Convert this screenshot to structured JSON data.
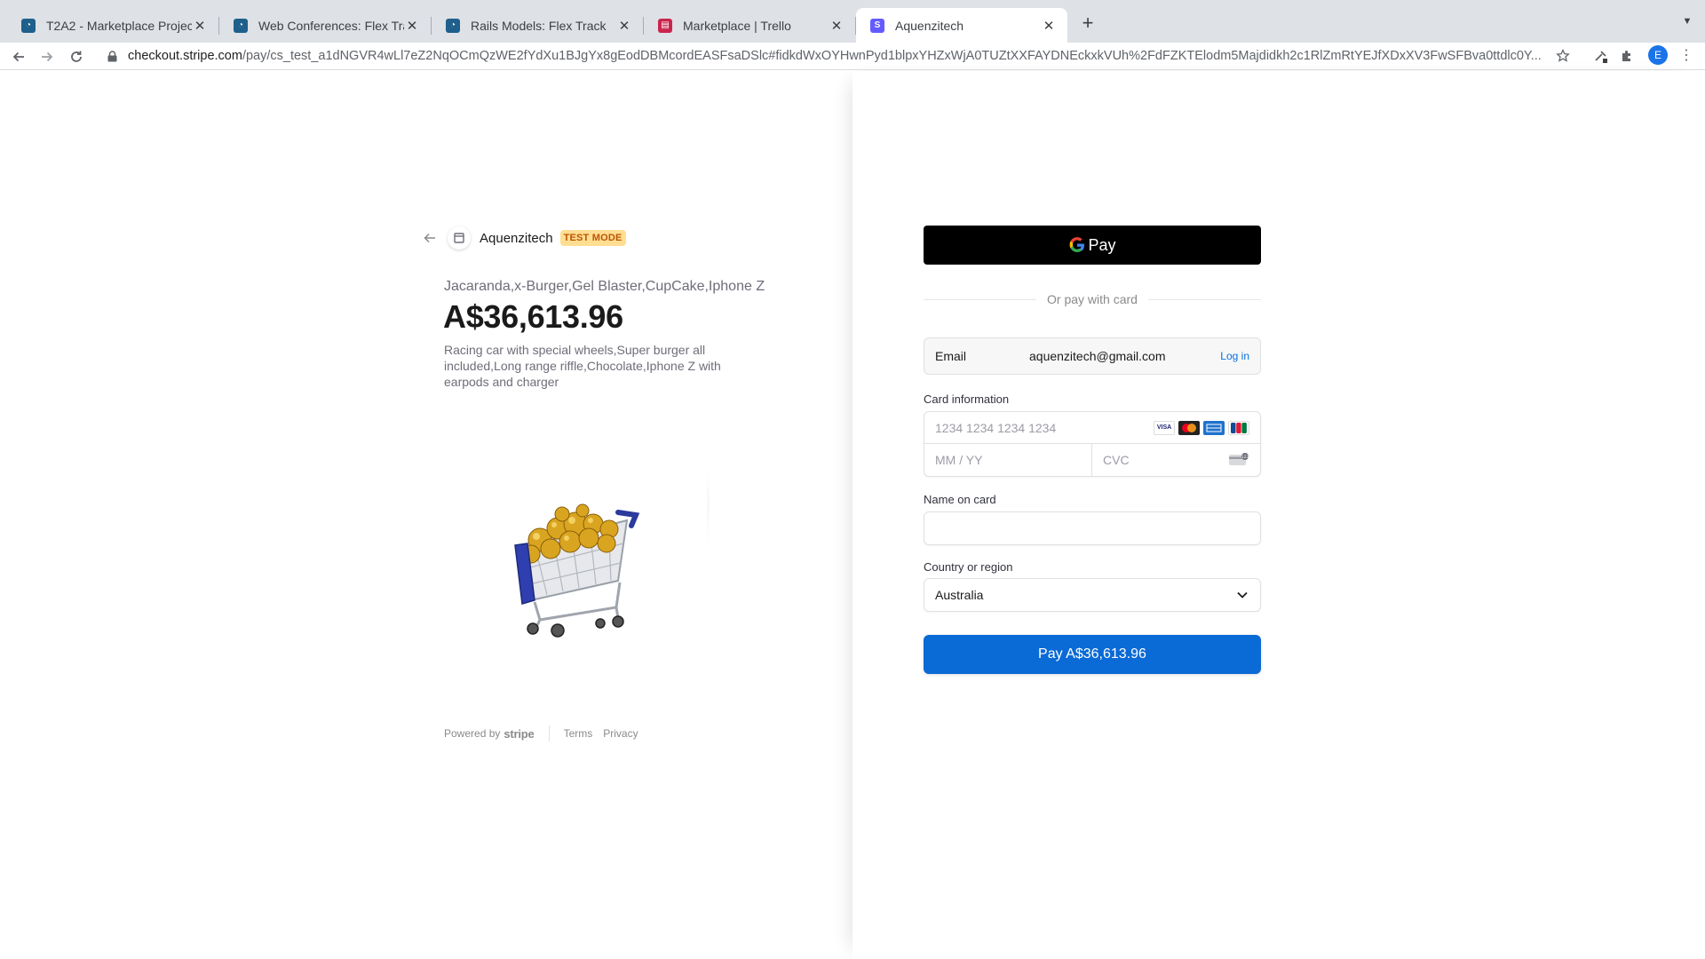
{
  "browser": {
    "tabs": [
      {
        "title": "T2A2 - Marketplace Project",
        "favicon": "canvas-icon",
        "active": false
      },
      {
        "title": "Web Conferences: Flex Track",
        "favicon": "canvas-icon",
        "active": false
      },
      {
        "title": "Rails Models: Flex Track",
        "favicon": "canvas-icon",
        "active": false
      },
      {
        "title": "Marketplace | Trello",
        "favicon": "trello-icon",
        "active": false
      },
      {
        "title": "Aquenzitech",
        "favicon": "stripe-icon",
        "active": true
      }
    ],
    "new_tab": "+",
    "url_host": "checkout.stripe.com",
    "url_path": "/pay/cs_test_a1dNGVR4wLl7eZ2NqOCmQzWE2fYdXu1BJgYx8gEodDBMcordEASFsaDSlc#fidkdWxOYHwnPyd1blpxYHZxWjA0TUZtXXFAYDNEckxkVUh%2FdFZKTElodm5Majdidkh2c1RlZmRtYEJfXDxXV3FwSFBva0ttdlc0Y...",
    "profile_initial": "E"
  },
  "merchant": {
    "name": "Aquenzitech",
    "badge": "TEST MODE"
  },
  "order": {
    "product_names": "Jacaranda,x-Burger,Gel Blaster,CupCake,Iphone Z",
    "amount": "A$36,613.96",
    "description": "Racing car with special wheels,Super burger all included,Long range riffle,Chocolate,Iphone Z with earpods and charger",
    "image": "shopping-cart-with-gold"
  },
  "footer": {
    "powered_by": "Powered by",
    "brand": "stripe",
    "terms": "Terms",
    "privacy": "Privacy"
  },
  "form": {
    "gpay_label": "Pay",
    "divider_text": "Or pay with card",
    "email_label": "Email",
    "email_value": "aquenzitech@gmail.com",
    "login_link": "Log in",
    "card_label": "Card information",
    "card_number_placeholder": "1234 1234 1234 1234",
    "card_brands": [
      "VISA",
      "Mastercard",
      "AMEX",
      "JCB"
    ],
    "expiry_placeholder": "MM / YY",
    "cvc_placeholder": "CVC",
    "name_label": "Name on card",
    "name_value": "",
    "country_label": "Country or region",
    "country_value": "Australia",
    "pay_button": "Pay A$36,613.96"
  },
  "colors": {
    "pay_button": "#0a6ad6",
    "test_badge_bg": "#ffde92",
    "test_badge_text": "#bb5504",
    "link": "#0570de"
  }
}
